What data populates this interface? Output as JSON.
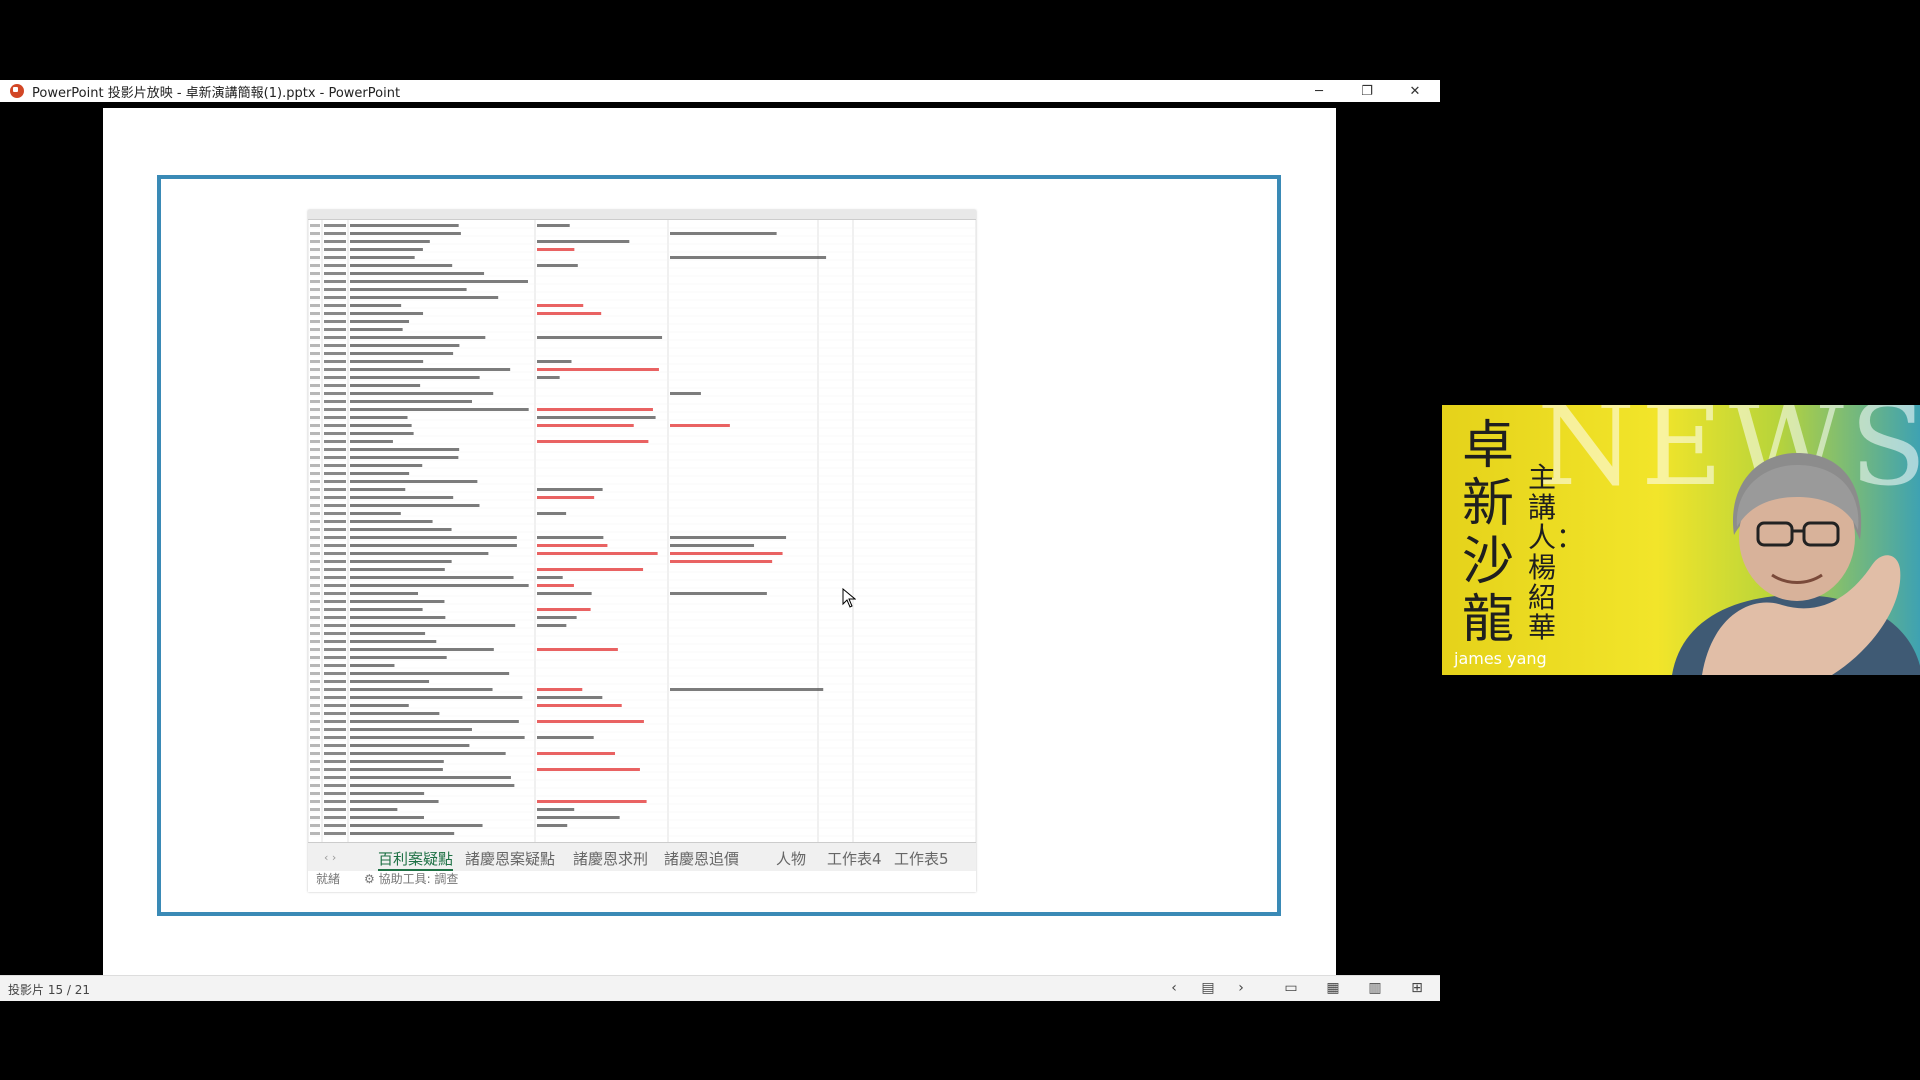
{
  "window": {
    "title": "PowerPoint 投影片放映 - 卓新演講簡報(1).pptx - PowerPoint",
    "controls": {
      "minimize": "─",
      "maximize": "❐",
      "close": "✕"
    }
  },
  "sheet": {
    "tabs": [
      "百利案疑點",
      "諸慶恩案疑點",
      "諸慶恩求刑",
      "諸慶恩追價",
      "人物",
      "工作表4",
      "工作表5"
    ],
    "active_tab_index": 0,
    "status_text": "就緒　　⚙ 協助工具: 調查",
    "nav": "‹  ›"
  },
  "statusbar": {
    "slide_counter": "投影片 15 / 21",
    "icons": [
      "prev-icon",
      "slide-list-icon",
      "next-icon",
      "normal-view-icon",
      "sorter-view-icon",
      "reading-view-icon",
      "slideshow-icon"
    ]
  },
  "webcam": {
    "title": "卓新沙龍",
    "subtitle": "主講人：楊紹華",
    "name": "james yang",
    "bg_word": "NEWS"
  },
  "colors": {
    "frame": "#3a8ab6",
    "tab_active": "#1e7145",
    "accent_red": "#e02020"
  }
}
